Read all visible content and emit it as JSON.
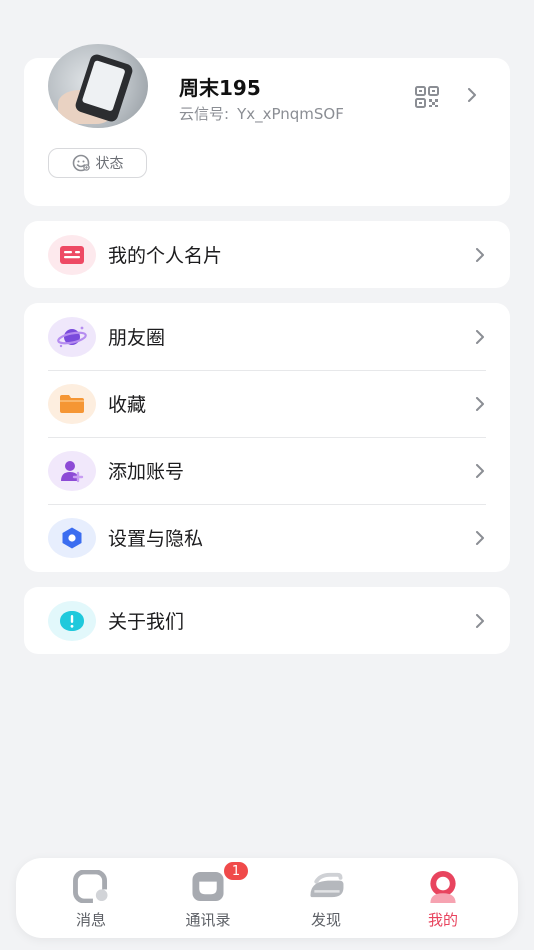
{
  "profile": {
    "name": "周末195",
    "id_label": "云信号:",
    "id_value": "Yx_xPnqmSOF",
    "status_label": "状态"
  },
  "menu": {
    "card_label": "我的个人名片",
    "moments": "朋友圈",
    "favorites": "收藏",
    "add_account": "添加账号",
    "settings": "设置与隐私",
    "about": "关于我们"
  },
  "tabs": [
    {
      "label": "消息",
      "icon": "message-icon"
    },
    {
      "label": "通讯录",
      "icon": "contacts-icon",
      "badge": "1"
    },
    {
      "label": "发现",
      "icon": "discover-icon"
    },
    {
      "label": "我的",
      "icon": "me-icon",
      "active": true
    }
  ],
  "colors": {
    "accent": "#e8445e",
    "badge": "#f04a4a",
    "card_icon": "#ee4a64",
    "moments_icon": "#7a4bdc",
    "favorites_icon": "#f59634",
    "add_account_icon": "#8d4bd6",
    "settings_icon": "#3b6df0",
    "about_icon": "#1fc9dc"
  }
}
